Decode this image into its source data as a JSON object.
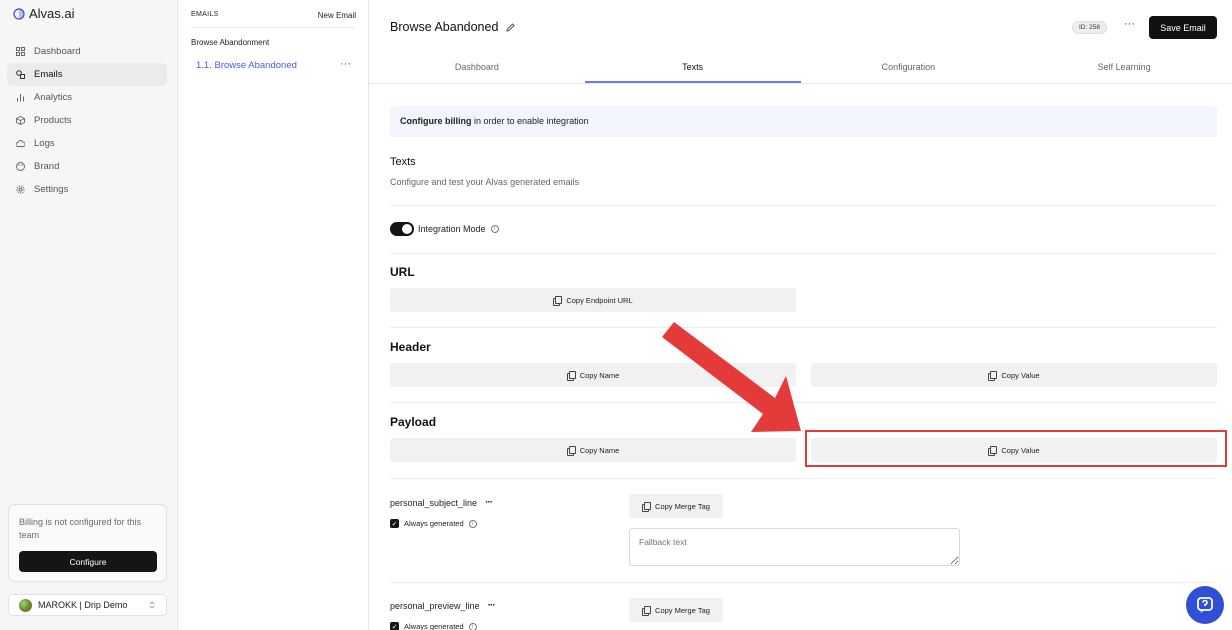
{
  "app": {
    "name": "Alvas.ai"
  },
  "sidebar": {
    "items": [
      {
        "label": "Dashboard",
        "icon": "grid-icon"
      },
      {
        "label": "Emails",
        "icon": "mail-shapes-icon"
      },
      {
        "label": "Analytics",
        "icon": "bar-chart-icon"
      },
      {
        "label": "Products",
        "icon": "cube-icon"
      },
      {
        "label": "Logs",
        "icon": "cloud-icon"
      },
      {
        "label": "Brand",
        "icon": "palette-icon"
      },
      {
        "label": "Settings",
        "icon": "gear-icon"
      }
    ],
    "billing_text": "Billing is not configured for this team",
    "configure_label": "Configure",
    "team_name": "MAROKK | Drip Demo"
  },
  "emails": {
    "section_label": "EMAILS",
    "new_email_label": "New Email",
    "group_title": "Browse Abandonment",
    "item_label": "1.1. Browse Abandoned",
    "more_label": "···"
  },
  "header": {
    "title": "Browse Abandoned",
    "id_badge": "ID: 258",
    "more_label": "···",
    "save_label": "Save Email"
  },
  "tabs": [
    {
      "label": "Dashboard"
    },
    {
      "label": "Texts"
    },
    {
      "label": "Configuration"
    },
    {
      "label": "Self Learning"
    }
  ],
  "banner": {
    "bold": "Configure billing",
    "rest": " in order to enable integration"
  },
  "texts": {
    "title": "Texts",
    "subtitle": "Configure and test your Alvas generated emails",
    "integration_label": "Integration Mode",
    "info_glyph": "i"
  },
  "url": {
    "title": "URL",
    "copy_endpoint": "Copy Endpoint URL"
  },
  "header_section": {
    "title": "Header",
    "copy_name": "Copy Name",
    "copy_value": "Copy Value"
  },
  "payload": {
    "title": "Payload",
    "copy_name": "Copy Name",
    "copy_value": "Copy Value"
  },
  "variables": [
    {
      "name": "personal_subject_line",
      "always_generated": "Always generated",
      "copy_merge": "Copy Merge Tag",
      "fallback_placeholder": "Fallback text"
    },
    {
      "name": "personal_preview_line",
      "always_generated": "Always generated",
      "copy_merge": "Copy Merge Tag"
    }
  ],
  "colors": {
    "accent": "#4b5bd7",
    "tab_underline": "#6a7cf0",
    "arrow": "#e43a3a",
    "fab": "#2e4fd6"
  }
}
